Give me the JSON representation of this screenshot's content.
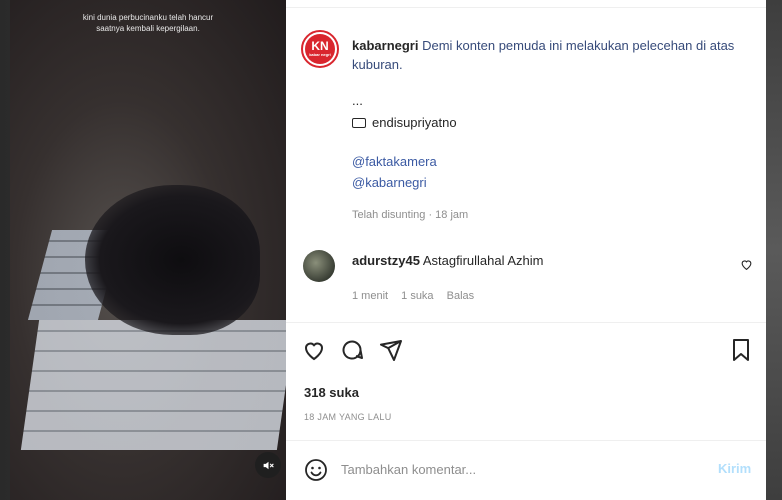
{
  "media": {
    "caption_line1": "kini dunia perbucinanku telah hancur",
    "caption_line2": "saatnya kembali kepergilaan."
  },
  "post": {
    "author": "kabarnegri",
    "avatar_text": "KN",
    "avatar_subtext": "kabar negri",
    "caption": "Demi konten pemuda ini melakukan pelecehan di atas kuburan.",
    "ellipsis": "...",
    "credit_user": "endisupriyatno",
    "tag1": "@faktakamera",
    "tag2": "@kabarnegri",
    "edited_meta": "Telah disunting · 18 jam"
  },
  "comment": {
    "user": "adurstzy45",
    "text": "Astagfirullahal Azhim",
    "time": "1 menit",
    "likes": "1 suka",
    "reply": "Balas"
  },
  "stats": {
    "likes": "318 suka",
    "timestamp": "18 JAM YANG LALU"
  },
  "composer": {
    "placeholder": "Tambahkan komentar...",
    "post_label": "Kirim"
  },
  "icons": {
    "like": "heart-icon",
    "comment": "comment-icon",
    "share": "send-icon",
    "save": "bookmark-icon",
    "emoji": "emoji-icon",
    "mute": "muted-speaker-icon"
  },
  "colors": {
    "link": "#3b5aa3",
    "brand_red": "#d9262e",
    "muted": "#8e8e8e",
    "post_button": "#b2dffc"
  }
}
